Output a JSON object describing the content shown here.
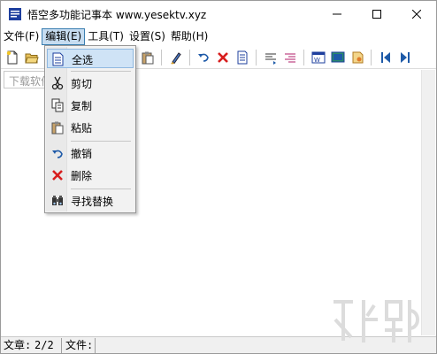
{
  "window": {
    "title": "悟空多功能记事本 www.yesektv.xyz",
    "controls": [
      "minimize",
      "maximize",
      "close"
    ]
  },
  "menubar": {
    "items": [
      {
        "label": "文件(F)"
      },
      {
        "label": "编辑(E)",
        "active": true
      },
      {
        "label": "工具(T)"
      },
      {
        "label": "设置(S)"
      },
      {
        "label": "帮助(H)"
      }
    ]
  },
  "toolbar": {
    "icons": [
      "new-file-icon",
      "open-folder-icon",
      "paste-icon",
      "format-brush-icon",
      "undo-icon",
      "delete-icon",
      "document-icon",
      "align-left-icon",
      "align-right-icon",
      "word-icon",
      "screen-icon",
      "note-icon",
      "first-page-icon",
      "last-page-icon"
    ]
  },
  "tab": {
    "label": "下载软件"
  },
  "edit_menu": {
    "items": [
      {
        "label": "全选",
        "icon": "select-all-icon",
        "highlighted": true
      },
      {
        "label": "剪切",
        "icon": "scissors-icon"
      },
      {
        "label": "复制",
        "icon": "copy-icon"
      },
      {
        "label": "粘贴",
        "icon": "paste-icon"
      },
      {
        "label": "撤销",
        "icon": "undo-icon"
      },
      {
        "label": "删除",
        "icon": "delete-icon"
      },
      {
        "label": "寻找替换",
        "icon": "binoculars-icon"
      }
    ]
  },
  "statusbar": {
    "article_label": "文章:",
    "article_value": "2/2",
    "file_label": "文件:",
    "file_value": ""
  },
  "colors": {
    "menu_highlight": "#c6dcf0",
    "menu_highlight_border": "#3c7fb1",
    "accent_blue": "#1e5aa8",
    "delete_red": "#d81e1e"
  }
}
